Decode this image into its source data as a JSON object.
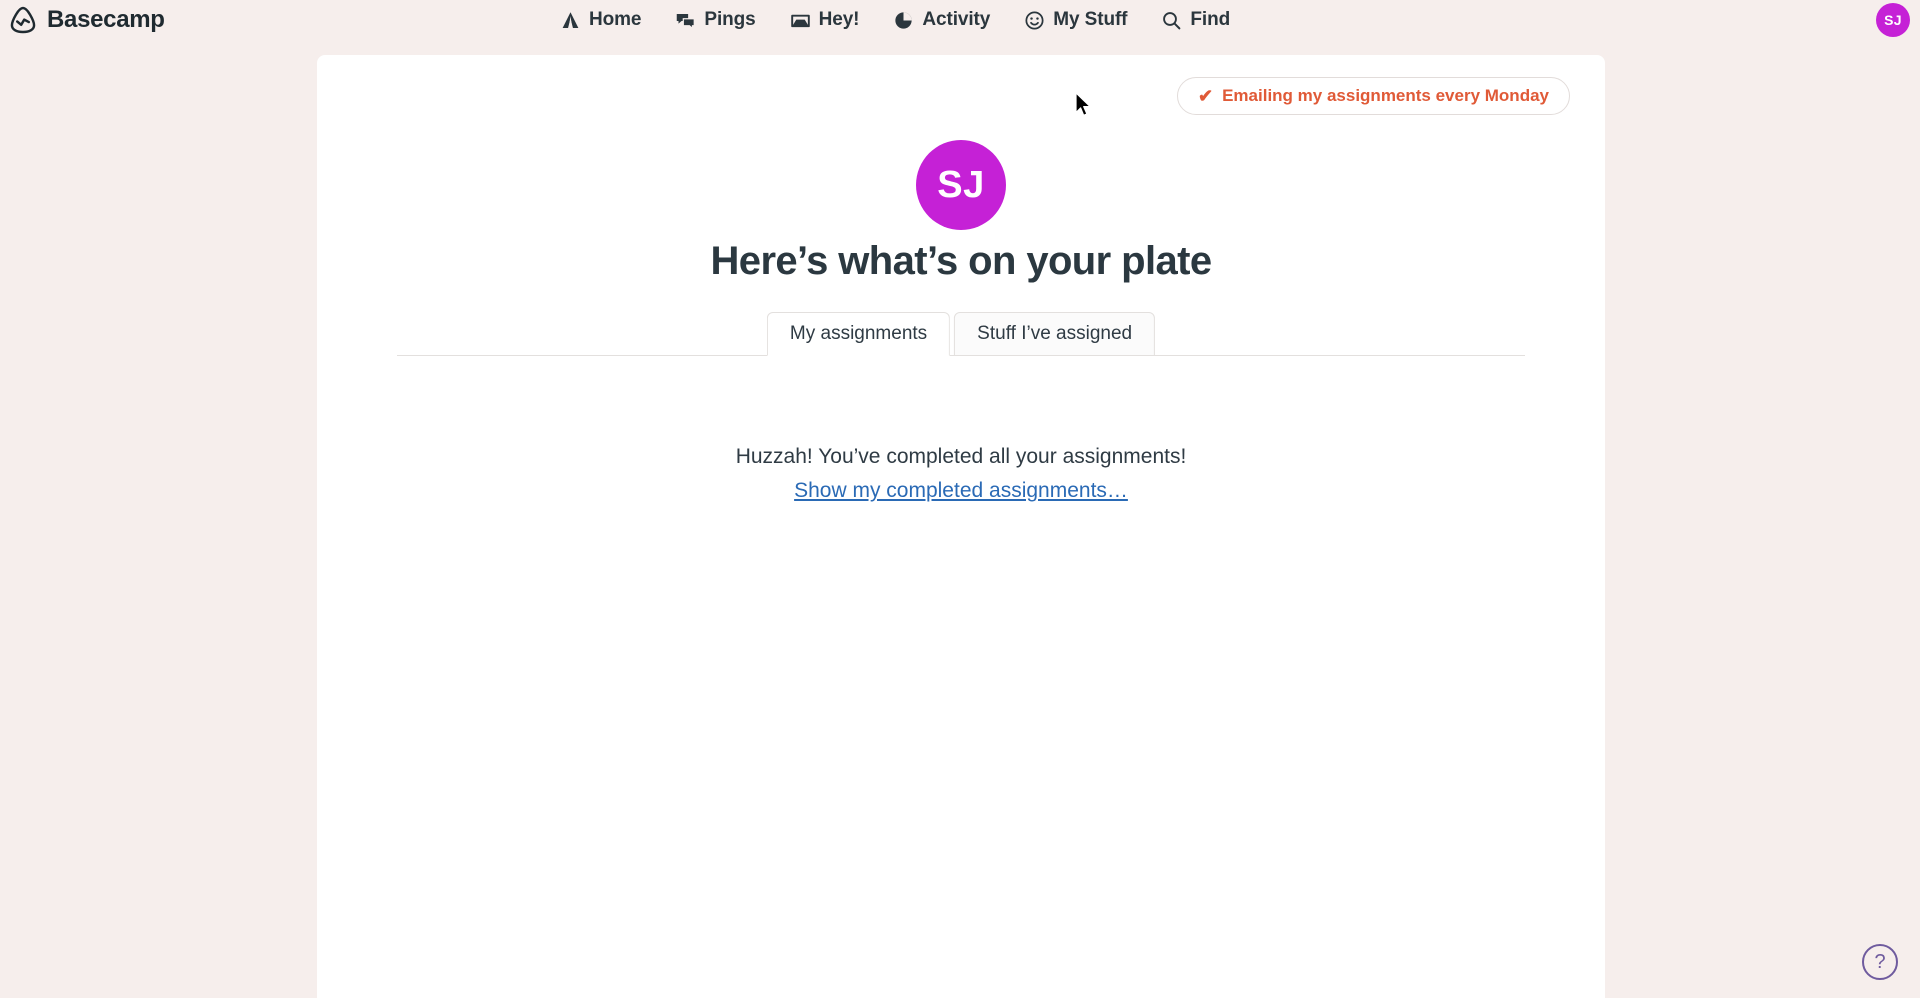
{
  "app": {
    "brand_name": "Basecamp",
    "brand_logo_icon": "basecamp-logo-icon",
    "background_color": "#f6eeec",
    "accent_magenta": "#c521d6",
    "accent_orange": "#e05a37",
    "link_blue": "#2a6ab5",
    "help_purple": "#6f5b9e"
  },
  "nav": {
    "items": [
      {
        "label": "Home",
        "icon": "tent-icon"
      },
      {
        "label": "Pings",
        "icon": "speech-bubbles-icon"
      },
      {
        "label": "Hey!",
        "icon": "inbox-tray-icon"
      },
      {
        "label": "Activity",
        "icon": "pie-chart-icon"
      },
      {
        "label": "My Stuff",
        "icon": "smiley-face-icon"
      },
      {
        "label": "Find",
        "icon": "magnifying-glass-icon"
      }
    ],
    "avatar_initials": "SJ"
  },
  "card": {
    "email_pill": {
      "check_glyph": "✔",
      "label": "Emailing my assignments every Monday"
    },
    "avatar_initials": "SJ",
    "title": "Here’s what’s on your plate",
    "tabs": [
      {
        "label": "My assignments",
        "active": true
      },
      {
        "label": "Stuff I’ve assigned",
        "active": false
      }
    ],
    "empty_state": {
      "message": "Huzzah! You’ve completed all your assignments!",
      "link_label": "Show my completed assignments…"
    }
  },
  "help": {
    "glyph": "?",
    "name": "help-button"
  }
}
